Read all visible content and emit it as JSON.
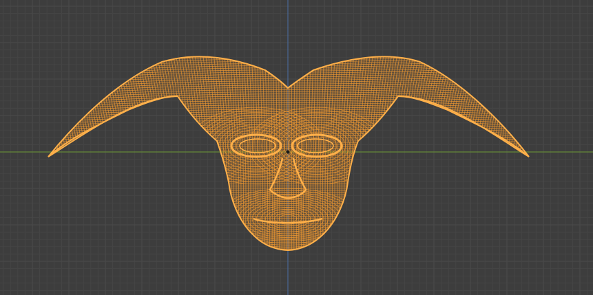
{
  "viewport": {
    "background_color": "#3d3d3d",
    "grid_minor_color": "#454545",
    "grid_major_color": "#4a4a4a",
    "x_axis_color": "#6d9a35",
    "y_axis_color": "#4a70a6",
    "wire_color": "#f29a31",
    "wire_highlight_color": "#ffb04a",
    "origin_color": "#1a1a1a",
    "view": "front-orthographic",
    "shading": "wireframe",
    "selected_object": "mask-mesh"
  }
}
